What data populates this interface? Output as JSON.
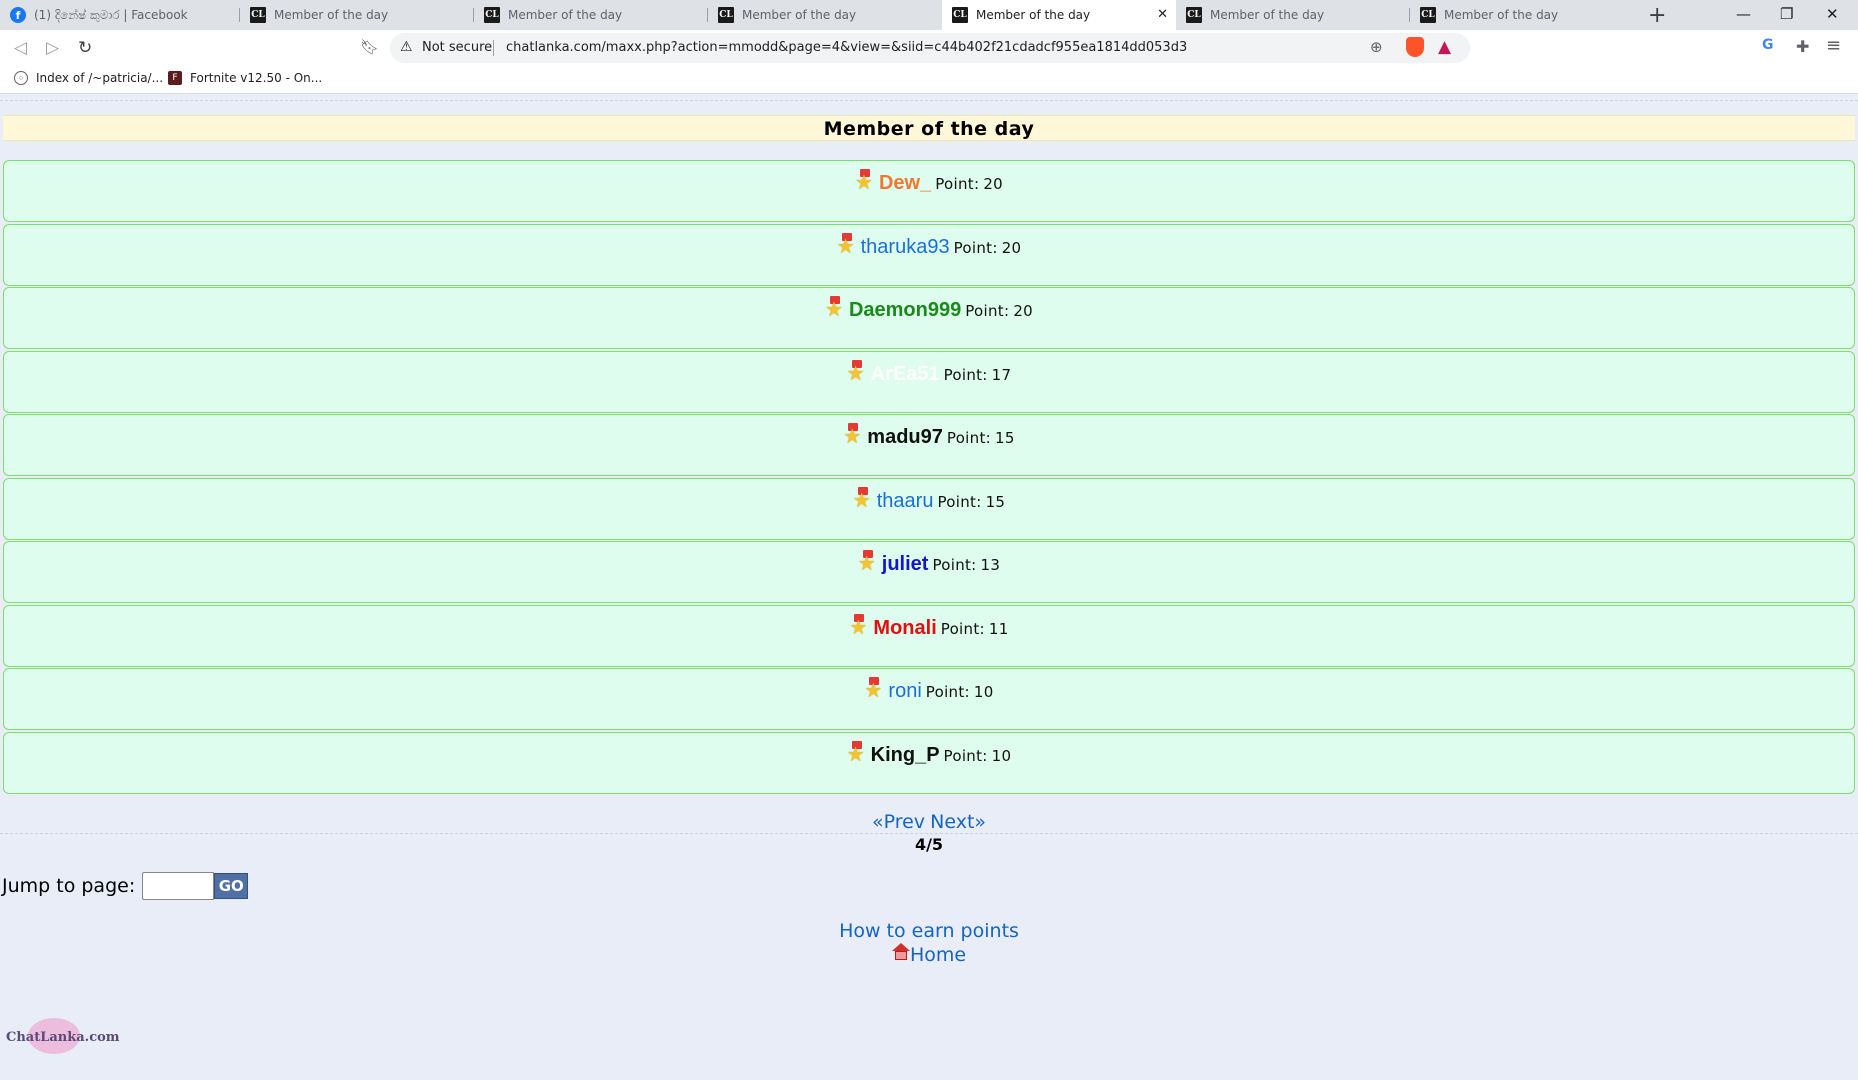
{
  "browser": {
    "tabs": [
      {
        "title": "(1) දිනේෂ් කුමාර | Facebook",
        "favicon": "facebook-icon",
        "active": false
      },
      {
        "title": "Member of the day",
        "favicon": "chatlanka-icon",
        "active": false
      },
      {
        "title": "Member of the day",
        "favicon": "chatlanka-icon",
        "active": false
      },
      {
        "title": "Member of the day",
        "favicon": "chatlanka-icon",
        "active": false
      },
      {
        "title": "Member of the day",
        "favicon": "chatlanka-icon",
        "active": true
      },
      {
        "title": "Member of the day",
        "favicon": "chatlanka-icon",
        "active": false
      },
      {
        "title": "Member of the day",
        "favicon": "chatlanka-icon",
        "active": false
      }
    ],
    "security_label": "Not secure",
    "url": "chatlanka.com/maxx.php?action=mmodd&page=4&view=&siid=c44b402f21cdadcf955ea1814dd053d3",
    "bookmarks": [
      {
        "label": "Index of /~patricia/...",
        "icon": "globe-icon"
      },
      {
        "label": "Fortnite v12.50 - On...",
        "icon": "fortnite-icon"
      }
    ]
  },
  "page": {
    "title": "Member of the day",
    "point_label": "Point:",
    "members": [
      {
        "name": "Dew_",
        "points": "20",
        "color": "#f07830",
        "bold": true
      },
      {
        "name": "tharuka93",
        "points": "20",
        "color": "#1a6fd6",
        "bold": false
      },
      {
        "name": "Daemon999",
        "points": "20",
        "color": "#1a8a1a",
        "bold": true
      },
      {
        "name": "ArEa51",
        "points": "17",
        "color": "#ffffff",
        "bold": true
      },
      {
        "name": "madu97",
        "points": "15",
        "color": "#111111",
        "bold": true
      },
      {
        "name": "thaaru",
        "points": "15",
        "color": "#1a6fd6",
        "bold": false
      },
      {
        "name": "juliet",
        "points": "13",
        "color": "#1515c8",
        "bold": true
      },
      {
        "name": "Monali",
        "points": "11",
        "color": "#e01010",
        "bold": true
      },
      {
        "name": "roni",
        "points": "10",
        "color": "#1a6fd6",
        "bold": false
      },
      {
        "name": "King_P",
        "points": "10",
        "color": "#111111",
        "bold": true
      }
    ],
    "pager": {
      "prev": "«Prev",
      "next": "Next»",
      "page_indicator": "4/5"
    },
    "jump": {
      "label": "Jump to page:",
      "value": "",
      "go": "GO"
    },
    "earn_link": "How to earn points",
    "home_link": "Home",
    "logo": "ChatLanka.com"
  }
}
